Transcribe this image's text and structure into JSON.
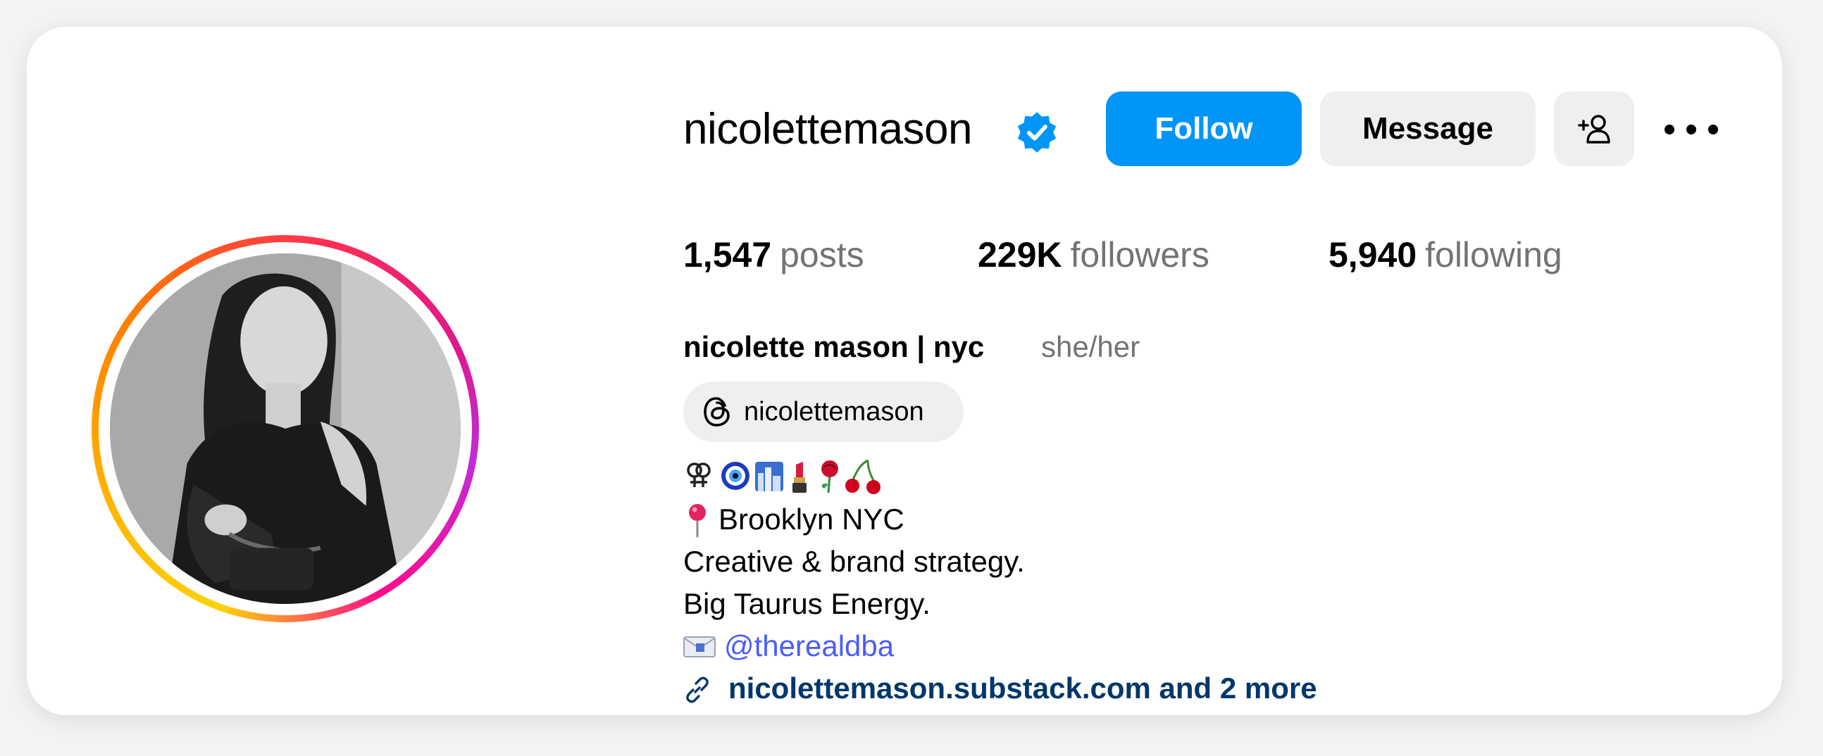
{
  "profile": {
    "username": "nicolettemason",
    "verified": true,
    "full_name": "nicolette mason | nyc",
    "pronouns": "she/her"
  },
  "actions": {
    "follow_label": "Follow",
    "message_label": "Message"
  },
  "stats": {
    "posts_count": "1,547",
    "posts_label": "posts",
    "followers_count": "229K",
    "followers_label": "followers",
    "following_count": "5,940",
    "following_label": "following"
  },
  "threads": {
    "handle": "nicolettemason"
  },
  "bio": {
    "emoji_line": [
      "female-symbol",
      "nazar-amulet",
      "cityscape",
      "lipstick",
      "rose",
      "cherries"
    ],
    "location": "Brooklyn NYC",
    "line2": "Creative & brand strategy.",
    "line3": "Big Taurus Energy.",
    "mention": "@therealdba",
    "link": "nicolettemason.substack.com and 2 more"
  },
  "colors": {
    "follow_blue": "#0095f6",
    "link_navy": "#00376b",
    "mention_blue": "#4a5df9",
    "secondary_gray": "#737373",
    "button_gray": "#efefef"
  }
}
